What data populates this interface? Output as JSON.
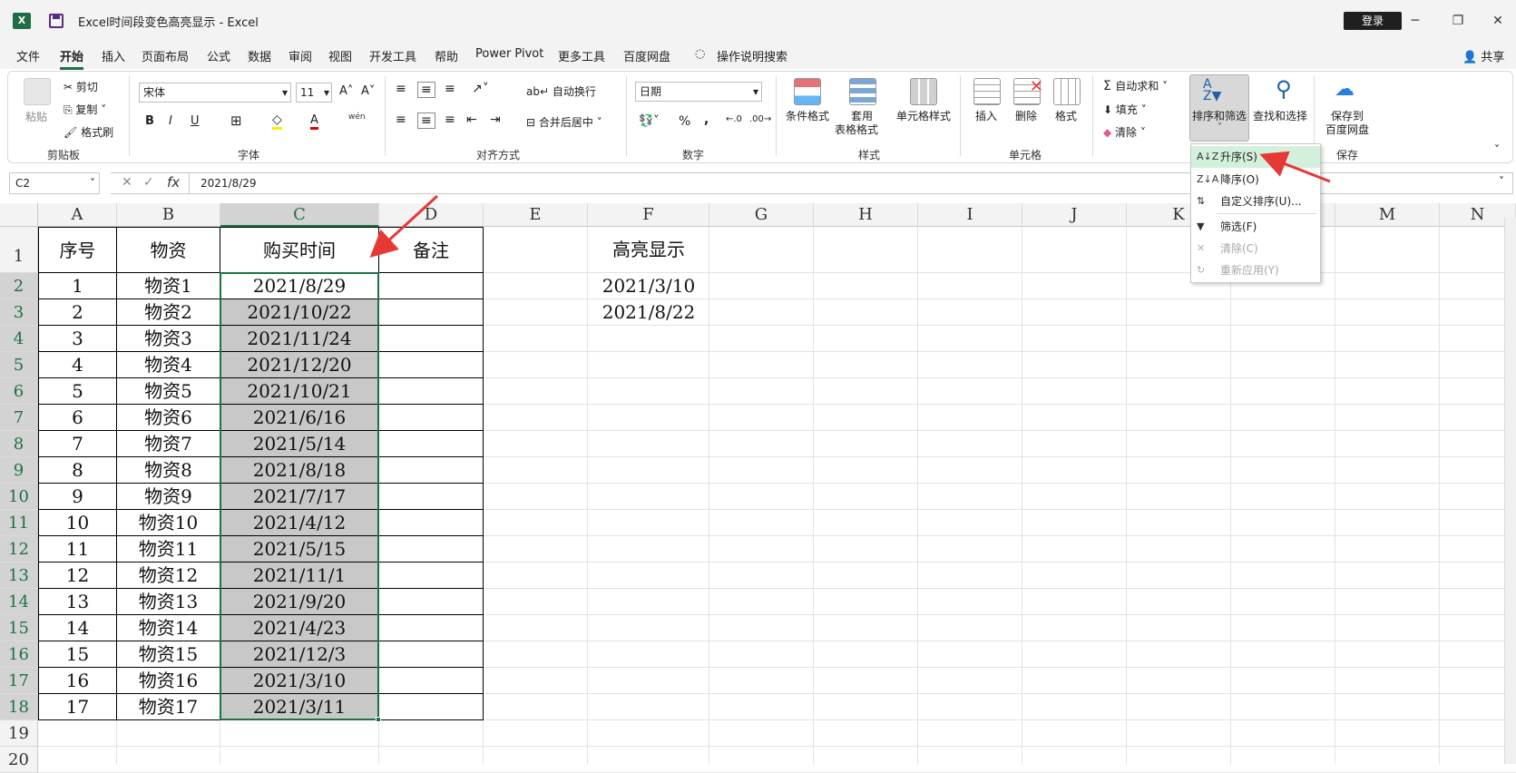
{
  "window": {
    "title": "Excel时间段变色高亮显示  -  Excel",
    "login": "登录",
    "share": "共享"
  },
  "menu": {
    "tabs": [
      "文件",
      "开始",
      "插入",
      "页面布局",
      "公式",
      "数据",
      "审阅",
      "视图",
      "开发工具",
      "帮助",
      "Power Pivot",
      "更多工具",
      "百度网盘"
    ],
    "active": "开始",
    "search": "操作说明搜索"
  },
  "ribbon": {
    "clipboard": {
      "paste": "粘贴",
      "cut": "剪切",
      "copy": "复制",
      "format_painter": "格式刷",
      "label": "剪贴板"
    },
    "font": {
      "name": "宋体",
      "size": "11",
      "label": "字体",
      "bold": "B",
      "italic": "I",
      "underline": "U",
      "increase": "A˄",
      "decrease": "A˅",
      "color_a": "A",
      "phonetic": "wén"
    },
    "alignment": {
      "wrap": "自动换行",
      "merge": "合并后居中",
      "label": "对齐方式"
    },
    "number": {
      "format": "日期",
      "percent": "%",
      "comma": ",",
      "label": "数字"
    },
    "styles": {
      "conditional": "条件格式",
      "table_format_1": "套用",
      "table_format_2": "表格格式",
      "cell_styles": "单元格样式",
      "label": "样式"
    },
    "cells": {
      "insert": "插入",
      "delete": "删除",
      "format": "格式",
      "label": "单元格"
    },
    "editing": {
      "autosum": "自动求和",
      "fill": "填充",
      "clear": "清除",
      "sort_filter": "排序和筛选",
      "find_select": "查找和选择"
    },
    "save": {
      "label_1": "保存到",
      "label_2": "百度网盘",
      "group": "保存"
    }
  },
  "formula_bar": {
    "name_box": "C2",
    "formula": "2021/8/29",
    "fx": "fx"
  },
  "sort_menu": {
    "items": [
      {
        "icon": "A↓Z",
        "label": "升序(S)",
        "highlight": true,
        "disabled": false
      },
      {
        "icon": "Z↓A",
        "label": "降序(O)",
        "highlight": false,
        "disabled": false
      },
      {
        "icon": "⇅",
        "label": "自定义排序(U)...",
        "highlight": false,
        "disabled": false
      },
      {
        "icon": "▼",
        "label": "筛选(F)",
        "highlight": false,
        "disabled": false
      },
      {
        "icon": "✕",
        "label": "清除(C)",
        "highlight": false,
        "disabled": true
      },
      {
        "icon": "↻",
        "label": "重新应用(Y)",
        "highlight": false,
        "disabled": true
      }
    ]
  },
  "sheet": {
    "columns": [
      "A",
      "B",
      "C",
      "D",
      "E",
      "F",
      "G",
      "H",
      "I",
      "J",
      "K",
      "L",
      "M",
      "N"
    ],
    "selected_column": "C",
    "rows": [
      "1",
      "2",
      "3",
      "4",
      "5",
      "6",
      "7",
      "8",
      "9",
      "10",
      "11",
      "12",
      "13",
      "14",
      "15",
      "16",
      "17",
      "18",
      "19",
      "20"
    ],
    "header": {
      "a": "序号",
      "b": "物资",
      "c": "购买时间",
      "d": "备注",
      "f": "高亮显示"
    },
    "data": [
      {
        "a": "1",
        "b": "物资1",
        "c": "2021/8/29"
      },
      {
        "a": "2",
        "b": "物资2",
        "c": "2021/10/22"
      },
      {
        "a": "3",
        "b": "物资3",
        "c": "2021/11/24"
      },
      {
        "a": "4",
        "b": "物资4",
        "c": "2021/12/20"
      },
      {
        "a": "5",
        "b": "物资5",
        "c": "2021/10/21"
      },
      {
        "a": "6",
        "b": "物资6",
        "c": "2021/6/16"
      },
      {
        "a": "7",
        "b": "物资7",
        "c": "2021/5/14"
      },
      {
        "a": "8",
        "b": "物资8",
        "c": "2021/8/18"
      },
      {
        "a": "9",
        "b": "物资9",
        "c": "2021/7/17"
      },
      {
        "a": "10",
        "b": "物资10",
        "c": "2021/4/12"
      },
      {
        "a": "11",
        "b": "物资11",
        "c": "2021/5/15"
      },
      {
        "a": "12",
        "b": "物资12",
        "c": "2021/11/1"
      },
      {
        "a": "13",
        "b": "物资13",
        "c": "2021/9/20"
      },
      {
        "a": "14",
        "b": "物资14",
        "c": "2021/4/23"
      },
      {
        "a": "15",
        "b": "物资15",
        "c": "2021/12/3"
      },
      {
        "a": "16",
        "b": "物资16",
        "c": "2021/3/10"
      },
      {
        "a": "17",
        "b": "物资17",
        "c": "2021/3/11"
      }
    ],
    "highlight_dates": [
      "2021/3/10",
      "2021/8/22"
    ],
    "colors": {
      "accent": "#1e7145",
      "selection_fill": "#c8c8c8",
      "arrow": "#e53935"
    }
  }
}
